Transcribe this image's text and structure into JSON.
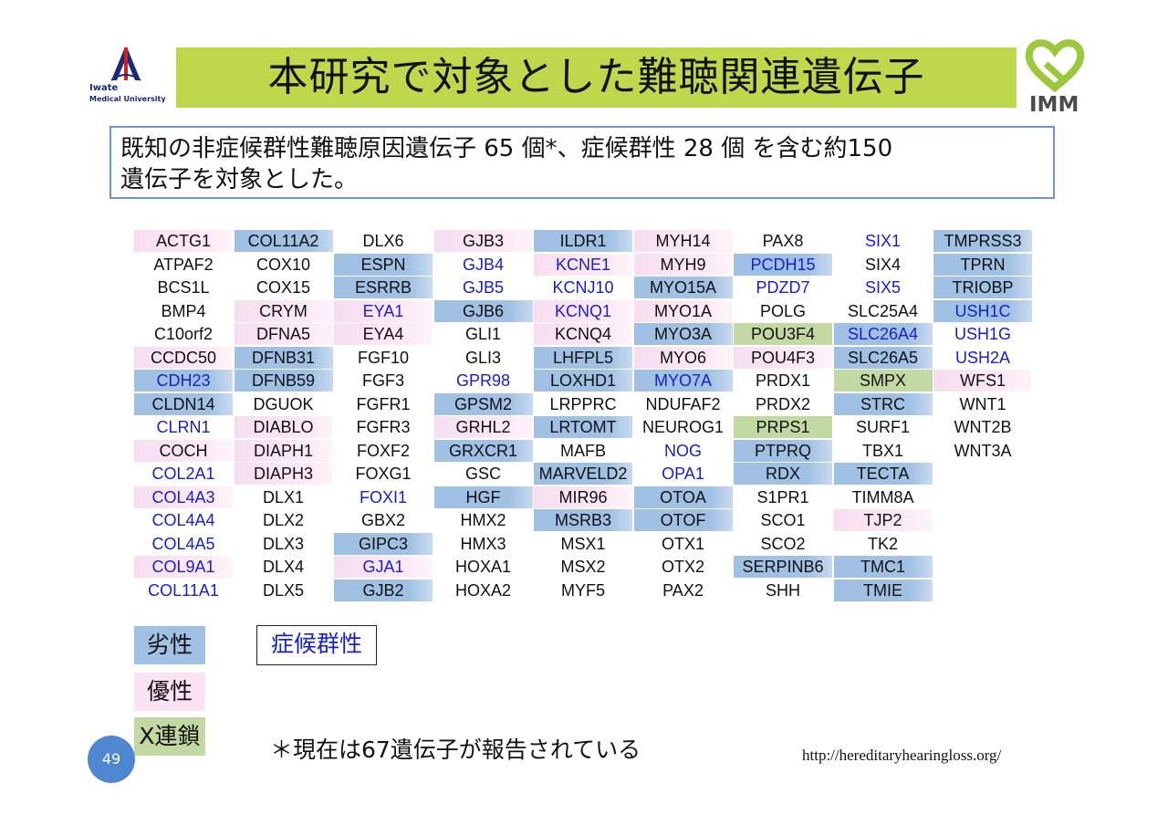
{
  "colors": {
    "title_bar": "#bdd84a",
    "recessive": "#a0c0e4",
    "dominant": "#f6def0",
    "x_linked": "#c3d9a3",
    "syndromic_text": "#1a20c8",
    "summary_border": "#6f97c4",
    "page_badge": "#4f86d2"
  },
  "header": {
    "left_logo": {
      "line1": "Iwate",
      "line2": "Medical University"
    },
    "title": "本研究で対象とした難聴関連遺伝子",
    "right_logo": {
      "text": "IMM"
    }
  },
  "summary": {
    "line1": "既知の非症候群性難聴原因遺伝子 65 個*、症候群性 28 個 を含む約150",
    "line2": "遺伝子を対象とした。"
  },
  "gene_table": {
    "columns": [
      [
        {
          "name": "ACTG1",
          "type": "dom",
          "syn": false
        },
        {
          "name": "ATPAF2",
          "type": "none",
          "syn": false
        },
        {
          "name": "BCS1L",
          "type": "none",
          "syn": false
        },
        {
          "name": "BMP4",
          "type": "none",
          "syn": false
        },
        {
          "name": "C10orf2",
          "type": "none",
          "syn": false
        },
        {
          "name": "CCDC50",
          "type": "dom",
          "syn": false
        },
        {
          "name": "CDH23",
          "type": "rec",
          "syn": true
        },
        {
          "name": "CLDN14",
          "type": "rec",
          "syn": false
        },
        {
          "name": "CLRN1",
          "type": "none",
          "syn": true
        },
        {
          "name": "COCH",
          "type": "dom",
          "syn": false
        },
        {
          "name": "COL2A1",
          "type": "none",
          "syn": true
        },
        {
          "name": "COL4A3",
          "type": "dom",
          "syn": true
        },
        {
          "name": "COL4A4",
          "type": "none",
          "syn": true
        },
        {
          "name": "COL4A5",
          "type": "none",
          "syn": true
        },
        {
          "name": "COL9A1",
          "type": "dom",
          "syn": true
        },
        {
          "name": "COL11A1",
          "type": "none",
          "syn": true
        }
      ],
      [
        {
          "name": "COL11A2",
          "type": "rec",
          "syn": false
        },
        {
          "name": "COX10",
          "type": "none",
          "syn": false
        },
        {
          "name": "COX15",
          "type": "none",
          "syn": false
        },
        {
          "name": "CRYM",
          "type": "dom",
          "syn": false
        },
        {
          "name": "DFNA5",
          "type": "dom",
          "syn": false
        },
        {
          "name": "DFNB31",
          "type": "rec",
          "syn": false
        },
        {
          "name": "DFNB59",
          "type": "rec",
          "syn": false
        },
        {
          "name": "DGUOK",
          "type": "none",
          "syn": false
        },
        {
          "name": "DIABLO",
          "type": "dom",
          "syn": false
        },
        {
          "name": "DIAPH1",
          "type": "dom",
          "syn": false
        },
        {
          "name": "DIAPH3",
          "type": "dom",
          "syn": false
        },
        {
          "name": "DLX1",
          "type": "none",
          "syn": false
        },
        {
          "name": "DLX2",
          "type": "none",
          "syn": false
        },
        {
          "name": "DLX3",
          "type": "none",
          "syn": false
        },
        {
          "name": "DLX4",
          "type": "none",
          "syn": false
        },
        {
          "name": "DLX5",
          "type": "none",
          "syn": false
        }
      ],
      [
        {
          "name": "DLX6",
          "type": "none",
          "syn": false
        },
        {
          "name": "ESPN",
          "type": "rec",
          "syn": false
        },
        {
          "name": "ESRRB",
          "type": "rec",
          "syn": false
        },
        {
          "name": "EYA1",
          "type": "dom",
          "syn": true
        },
        {
          "name": "EYA4",
          "type": "dom",
          "syn": false
        },
        {
          "name": "FGF10",
          "type": "none",
          "syn": false
        },
        {
          "name": "FGF3",
          "type": "none",
          "syn": false
        },
        {
          "name": "FGFR1",
          "type": "none",
          "syn": false
        },
        {
          "name": "FGFR3",
          "type": "none",
          "syn": false
        },
        {
          "name": "FOXF2",
          "type": "none",
          "syn": false
        },
        {
          "name": "FOXG1",
          "type": "none",
          "syn": false
        },
        {
          "name": "FOXI1",
          "type": "none",
          "syn": true
        },
        {
          "name": "GBX2",
          "type": "none",
          "syn": false
        },
        {
          "name": "GIPC3",
          "type": "rec",
          "syn": false
        },
        {
          "name": "GJA1",
          "type": "dom",
          "syn": true
        },
        {
          "name": "GJB2",
          "type": "rec",
          "syn": false
        }
      ],
      [
        {
          "name": "GJB3",
          "type": "dom",
          "syn": false
        },
        {
          "name": "GJB4",
          "type": "none",
          "syn": true
        },
        {
          "name": "GJB5",
          "type": "none",
          "syn": true
        },
        {
          "name": "GJB6",
          "type": "rec",
          "syn": false
        },
        {
          "name": "GLI1",
          "type": "none",
          "syn": false
        },
        {
          "name": "GLI3",
          "type": "none",
          "syn": false
        },
        {
          "name": "GPR98",
          "type": "none",
          "syn": true
        },
        {
          "name": "GPSM2",
          "type": "rec",
          "syn": false
        },
        {
          "name": "GRHL2",
          "type": "dom",
          "syn": false
        },
        {
          "name": "GRXCR1",
          "type": "rec",
          "syn": false
        },
        {
          "name": "GSC",
          "type": "none",
          "syn": false
        },
        {
          "name": "HGF",
          "type": "rec",
          "syn": false
        },
        {
          "name": "HMX2",
          "type": "none",
          "syn": false
        },
        {
          "name": "HMX3",
          "type": "none",
          "syn": false
        },
        {
          "name": "HOXA1",
          "type": "none",
          "syn": false
        },
        {
          "name": "HOXA2",
          "type": "none",
          "syn": false
        }
      ],
      [
        {
          "name": "ILDR1",
          "type": "rec",
          "syn": false
        },
        {
          "name": "KCNE1",
          "type": "dom",
          "syn": true
        },
        {
          "name": "KCNJ10",
          "type": "none",
          "syn": true
        },
        {
          "name": "KCNQ1",
          "type": "dom",
          "syn": true
        },
        {
          "name": "KCNQ4",
          "type": "dom",
          "syn": false
        },
        {
          "name": "LHFPL5",
          "type": "rec",
          "syn": false
        },
        {
          "name": "LOXHD1",
          "type": "rec",
          "syn": false
        },
        {
          "name": "LRPPRC",
          "type": "none",
          "syn": false
        },
        {
          "name": "LRTOMT",
          "type": "rec",
          "syn": false
        },
        {
          "name": "MAFB",
          "type": "none",
          "syn": false
        },
        {
          "name": "MARVELD2",
          "type": "rec",
          "syn": false
        },
        {
          "name": "MIR96",
          "type": "dom",
          "syn": false
        },
        {
          "name": "MSRB3",
          "type": "rec",
          "syn": false
        },
        {
          "name": "MSX1",
          "type": "none",
          "syn": false
        },
        {
          "name": "MSX2",
          "type": "none",
          "syn": false
        },
        {
          "name": "MYF5",
          "type": "none",
          "syn": false
        }
      ],
      [
        {
          "name": "MYH14",
          "type": "dom",
          "syn": false
        },
        {
          "name": "MYH9",
          "type": "dom",
          "syn": false
        },
        {
          "name": "MYO15A",
          "type": "rec",
          "syn": false
        },
        {
          "name": "MYO1A",
          "type": "dom",
          "syn": false
        },
        {
          "name": "MYO3A",
          "type": "rec",
          "syn": false
        },
        {
          "name": "MYO6",
          "type": "dom",
          "syn": false
        },
        {
          "name": "MYO7A",
          "type": "rec",
          "syn": true
        },
        {
          "name": "NDUFAF2",
          "type": "none",
          "syn": false
        },
        {
          "name": "NEUROG1",
          "type": "none",
          "syn": false
        },
        {
          "name": "NOG",
          "type": "none",
          "syn": true
        },
        {
          "name": "OPA1",
          "type": "none",
          "syn": true
        },
        {
          "name": "OTOA",
          "type": "rec",
          "syn": false
        },
        {
          "name": "OTOF",
          "type": "rec",
          "syn": false
        },
        {
          "name": "OTX1",
          "type": "none",
          "syn": false
        },
        {
          "name": "OTX2",
          "type": "none",
          "syn": false
        },
        {
          "name": "PAX2",
          "type": "none",
          "syn": false
        }
      ],
      [
        {
          "name": "PAX8",
          "type": "none",
          "syn": false
        },
        {
          "name": "PCDH15",
          "type": "rec",
          "syn": true
        },
        {
          "name": "PDZD7",
          "type": "none",
          "syn": true
        },
        {
          "name": "POLG",
          "type": "none",
          "syn": false
        },
        {
          "name": "POU3F4",
          "type": "xl",
          "syn": false
        },
        {
          "name": "POU4F3",
          "type": "dom",
          "syn": false
        },
        {
          "name": "PRDX1",
          "type": "none",
          "syn": false
        },
        {
          "name": "PRDX2",
          "type": "none",
          "syn": false
        },
        {
          "name": "PRPS1",
          "type": "xl",
          "syn": false
        },
        {
          "name": "PTPRQ",
          "type": "rec",
          "syn": false
        },
        {
          "name": "RDX",
          "type": "rec",
          "syn": false
        },
        {
          "name": "S1PR1",
          "type": "none",
          "syn": false
        },
        {
          "name": "SCO1",
          "type": "none",
          "syn": false
        },
        {
          "name": "SCO2",
          "type": "none",
          "syn": false
        },
        {
          "name": "SERPINB6",
          "type": "rec",
          "syn": false
        },
        {
          "name": "SHH",
          "type": "none",
          "syn": false
        }
      ],
      [
        {
          "name": "SIX1",
          "type": "none",
          "syn": true
        },
        {
          "name": "SIX4",
          "type": "none",
          "syn": false
        },
        {
          "name": "SIX5",
          "type": "none",
          "syn": true
        },
        {
          "name": "SLC25A4",
          "type": "none",
          "syn": false
        },
        {
          "name": "SLC26A4",
          "type": "rec",
          "syn": true
        },
        {
          "name": "SLC26A5",
          "type": "rec",
          "syn": false
        },
        {
          "name": "SMPX",
          "type": "xl",
          "syn": false
        },
        {
          "name": "STRC",
          "type": "rec",
          "syn": false
        },
        {
          "name": "SURF1",
          "type": "none",
          "syn": false
        },
        {
          "name": "TBX1",
          "type": "none",
          "syn": false
        },
        {
          "name": "TECTA",
          "type": "rec",
          "syn": false
        },
        {
          "name": "TIMM8A",
          "type": "none",
          "syn": false
        },
        {
          "name": "TJP2",
          "type": "dom",
          "syn": false
        },
        {
          "name": "TK2",
          "type": "none",
          "syn": false
        },
        {
          "name": "TMC1",
          "type": "rec",
          "syn": false
        },
        {
          "name": "TMIE",
          "type": "rec",
          "syn": false
        }
      ],
      [
        {
          "name": "TMPRSS3",
          "type": "rec",
          "syn": false
        },
        {
          "name": "TPRN",
          "type": "rec",
          "syn": false
        },
        {
          "name": "TRIOBP",
          "type": "rec",
          "syn": false
        },
        {
          "name": "USH1C",
          "type": "rec",
          "syn": true
        },
        {
          "name": "USH1G",
          "type": "none",
          "syn": true
        },
        {
          "name": "USH2A",
          "type": "none",
          "syn": true
        },
        {
          "name": "WFS1",
          "type": "dom",
          "syn": false
        },
        {
          "name": "WNT1",
          "type": "none",
          "syn": false
        },
        {
          "name": "WNT2B",
          "type": "none",
          "syn": false
        },
        {
          "name": "WNT3A",
          "type": "none",
          "syn": false
        }
      ]
    ]
  },
  "legend": {
    "recessive": "劣性",
    "dominant": "優性",
    "x_linked": "X連鎖",
    "syndromic": "症候群性"
  },
  "footnote": "＊現在は67遺伝子が報告されている",
  "url": "http://hereditaryhearingloss.org/",
  "page_number": "49"
}
